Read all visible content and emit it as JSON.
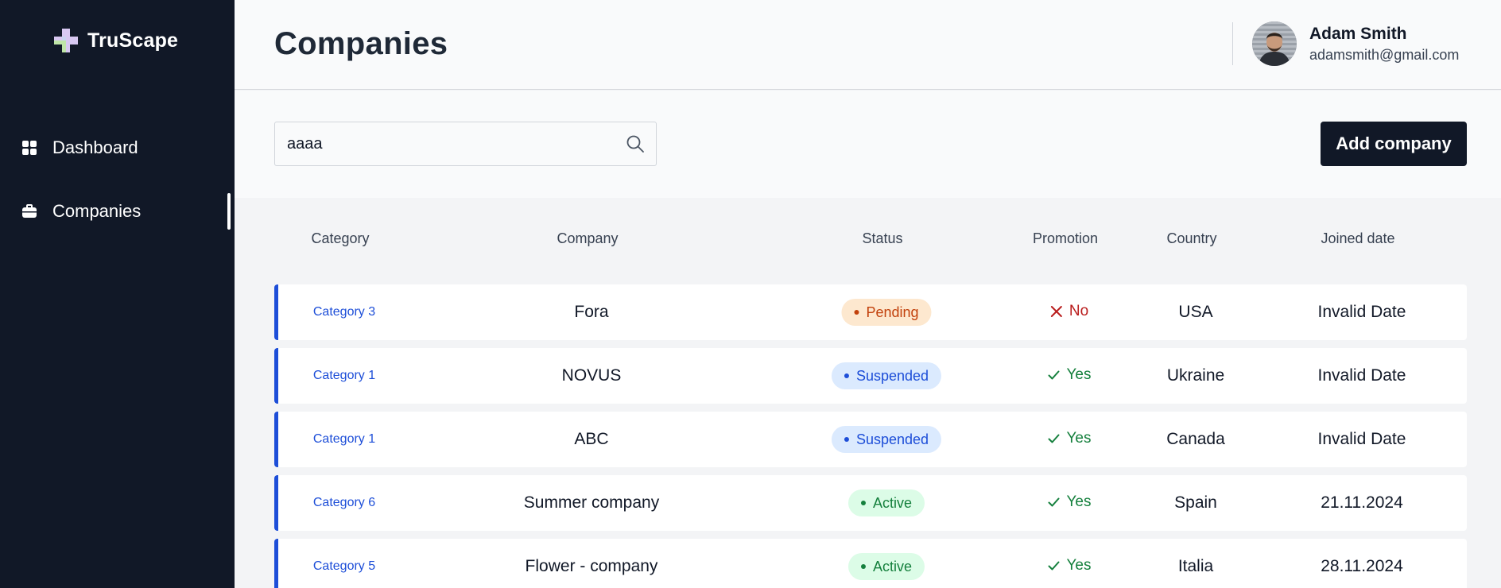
{
  "app": {
    "brand": "TruScape"
  },
  "sidebar": {
    "items": [
      {
        "label": "Dashboard",
        "icon": "dashboard-grid-icon",
        "active": false
      },
      {
        "label": "Companies",
        "icon": "briefcase-icon",
        "active": true
      }
    ]
  },
  "header": {
    "title": "Companies",
    "user": {
      "name": "Adam Smith",
      "email": "adamsmith@gmail.com"
    }
  },
  "toolbar": {
    "search_value": "aaaa",
    "search_icon": "search-icon",
    "add_label": "Add company"
  },
  "colors": {
    "sidebar_bg": "#111827",
    "accent": "#1d4ed8",
    "pending": "#c2410c",
    "suspended": "#1d4ed8",
    "active": "#15803d",
    "no": "#b91c1c"
  },
  "table": {
    "columns": [
      "Category",
      "Company",
      "Status",
      "Promotion",
      "Country",
      "Joined date"
    ],
    "rows": [
      {
        "category": "Category 3",
        "company": "Fora",
        "status": "Pending",
        "status_kind": "pending",
        "promotion": "No",
        "promotion_kind": "no",
        "country": "USA",
        "joined": "Invalid Date"
      },
      {
        "category": "Category 1",
        "company": "NOVUS",
        "status": "Suspended",
        "status_kind": "suspended",
        "promotion": "Yes",
        "promotion_kind": "yes",
        "country": "Ukraine",
        "joined": "Invalid Date"
      },
      {
        "category": "Category 1",
        "company": "ABC",
        "status": "Suspended",
        "status_kind": "suspended",
        "promotion": "Yes",
        "promotion_kind": "yes",
        "country": "Canada",
        "joined": "Invalid Date"
      },
      {
        "category": "Category 6",
        "company": "Summer company",
        "status": "Active",
        "status_kind": "active",
        "promotion": "Yes",
        "promotion_kind": "yes",
        "country": "Spain",
        "joined": "21.11.2024"
      },
      {
        "category": "Category 5",
        "company": "Flower - company",
        "status": "Active",
        "status_kind": "active",
        "promotion": "Yes",
        "promotion_kind": "yes",
        "country": "Italia",
        "joined": "28.11.2024"
      }
    ]
  }
}
